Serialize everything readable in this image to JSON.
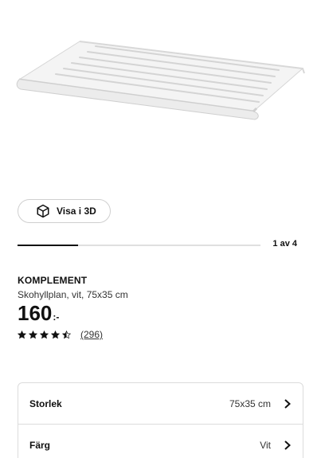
{
  "product_image": {
    "icon": "shoe-shelf-image"
  },
  "view3d": {
    "label": "Visa i 3D",
    "icon": "cube-icon"
  },
  "gallery": {
    "indicator": "1 av 4",
    "progress": 0.25
  },
  "product": {
    "name": "KOMPLEMENT",
    "description": "Skohyllplan, vit, 75x35 cm",
    "price": "160",
    "price_suffix": ":-",
    "rating": 4.5,
    "review_count": "(296)"
  },
  "options": [
    {
      "label": "Storlek",
      "value": "75x35 cm"
    },
    {
      "label": "Färg",
      "value": "Vit"
    }
  ],
  "colors": {
    "text": "#111111",
    "border": "#dcdcdc"
  }
}
